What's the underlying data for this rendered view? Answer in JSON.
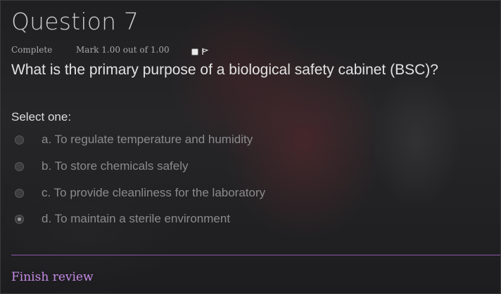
{
  "question": {
    "title": "Question 7",
    "state": "Complete",
    "grade": "Mark 1.00 out of 1.00",
    "flag_icon": "flag-icon",
    "text": "What is the primary purpose of a biological safety cabinet (BSC)?",
    "prompt": "Select one:",
    "answers": [
      {
        "label": "a. To regulate temperature and humidity",
        "selected": false
      },
      {
        "label": "b. To store chemicals safely",
        "selected": false
      },
      {
        "label": "c. To provide cleanliness for the laboratory",
        "selected": false
      },
      {
        "label": "d. To maintain a sterile environment",
        "selected": true
      }
    ]
  },
  "footer": {
    "finish_label": "Finish review"
  },
  "colors": {
    "link": "#c58be6",
    "divider": "#8a58a8"
  }
}
